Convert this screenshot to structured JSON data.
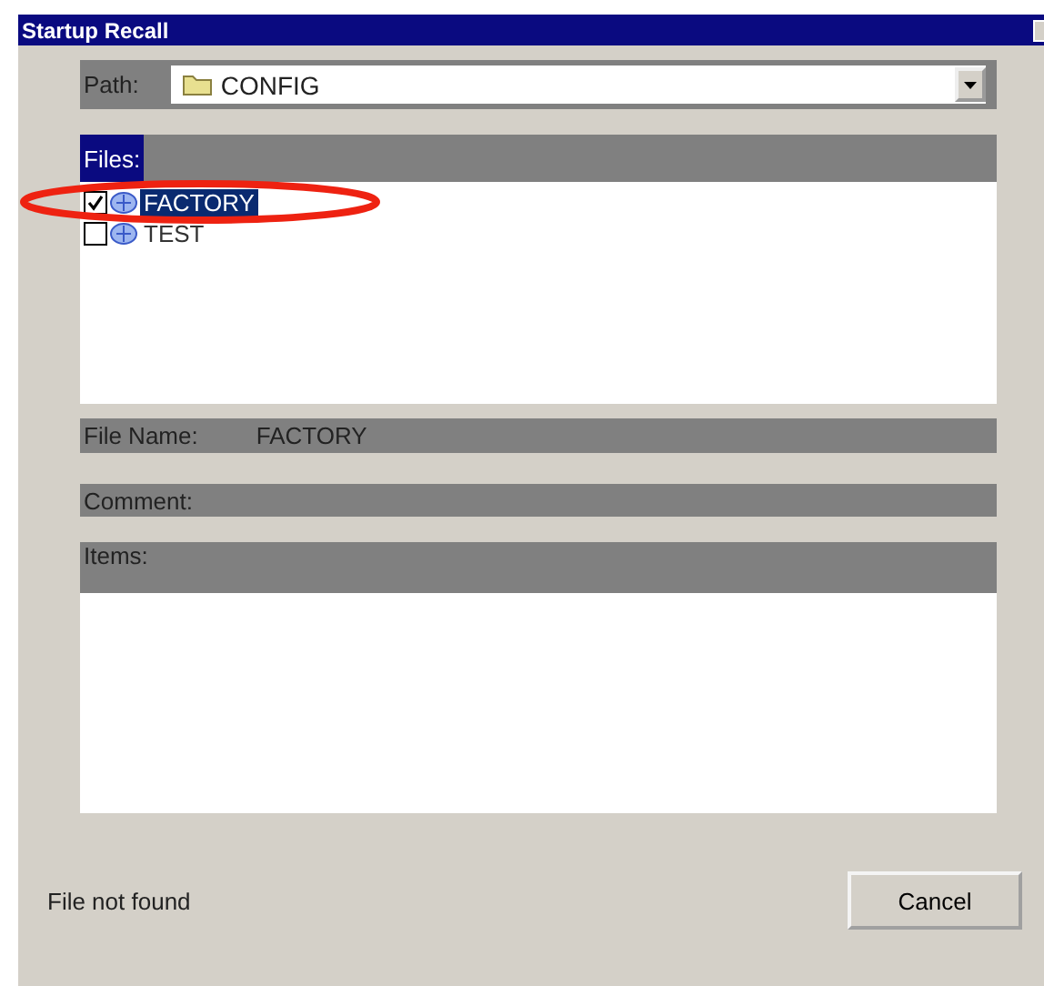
{
  "window": {
    "title": "Startup Recall"
  },
  "path": {
    "label": "Path:",
    "value": "CONFIG"
  },
  "files": {
    "label": "Files:",
    "focused": true,
    "items": [
      {
        "name": "FACTORY",
        "checked": true,
        "selected": true,
        "annotated": true
      },
      {
        "name": "TEST",
        "checked": false,
        "selected": false,
        "annotated": false
      }
    ]
  },
  "file_name": {
    "label": "File Name:",
    "value": "FACTORY"
  },
  "comment": {
    "label": "Comment:"
  },
  "items": {
    "label": "Items:"
  },
  "status": "File not found",
  "buttons": [
    "Cancel"
  ]
}
